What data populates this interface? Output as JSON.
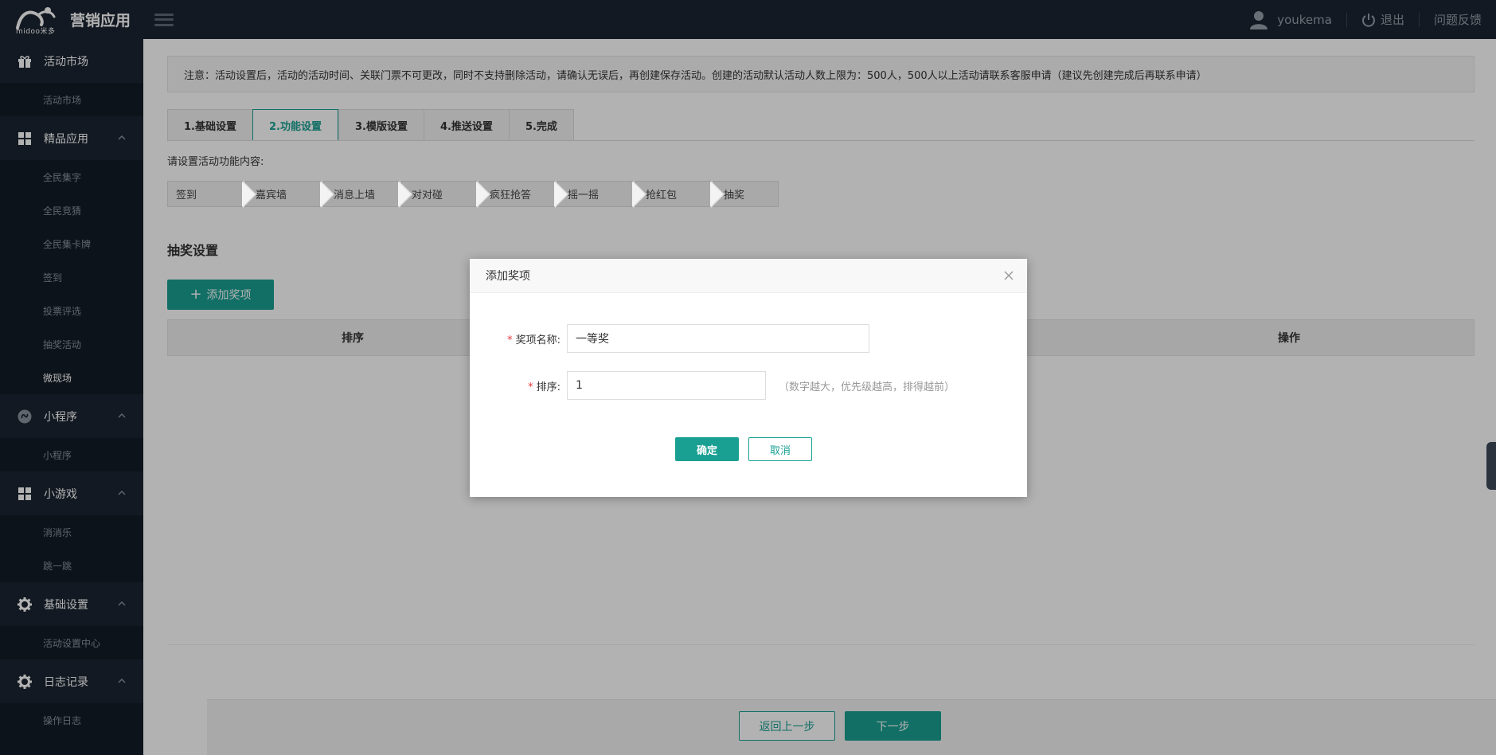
{
  "app": {
    "logo_text": "midoo米多",
    "title": "营销应用"
  },
  "topbar": {
    "username": "youkema",
    "logout": "退出",
    "feedback": "问题反馈"
  },
  "sidebar": {
    "groups": [
      {
        "label": "活动市场",
        "items": [
          "活动市场"
        ]
      },
      {
        "label": "精品应用",
        "items": [
          "全民集字",
          "全民竞猜",
          "全民集卡牌",
          "签到",
          "投票评选",
          "抽奖活动",
          "微现场"
        ]
      },
      {
        "label": "小程序",
        "items": [
          "小程序"
        ]
      },
      {
        "label": "小游戏",
        "items": [
          "消消乐",
          "跳一跳"
        ]
      },
      {
        "label": "基础设置",
        "items": [
          "活动设置中心"
        ]
      },
      {
        "label": "日志记录",
        "items": [
          "操作日志"
        ]
      }
    ]
  },
  "notice": "注意：活动设置后，活动的活动时间、关联门票不可更改，同时不支持删除活动，请确认无误后，再创建保存活动。创建的活动默认活动人数上限为：500人，500人以上活动请联系客服申请（建议先创建完成后再联系申请）",
  "tabs": [
    "1.基础设置",
    "2.功能设置",
    "3.模版设置",
    "4.推送设置",
    "5.完成"
  ],
  "function_prompt": "请设置活动功能内容:",
  "steps": [
    "签到",
    "嘉宾墙",
    "消息上墙",
    "对对碰",
    "疯狂抢答",
    "摇一摇",
    "抢红包",
    "抽奖"
  ],
  "lottery": {
    "section_title": "抽奖设置",
    "add_button": "添加奖项",
    "table_headers": {
      "sort": "排序",
      "actions": "操作"
    }
  },
  "footer": {
    "prev": "返回上一步",
    "next": "下一步"
  },
  "modal": {
    "title": "添加奖项",
    "name_label": "奖项名称:",
    "name_value": "一等奖",
    "sort_label": "排序:",
    "sort_value": "1",
    "sort_hint": "（数字越大，优先级越高，排得越前）",
    "required_mark": "*",
    "ok": "确定",
    "cancel": "取消"
  },
  "colors": {
    "accent": "#1aa092",
    "topbar": "#1b2431",
    "sidebar": "#141c26"
  }
}
